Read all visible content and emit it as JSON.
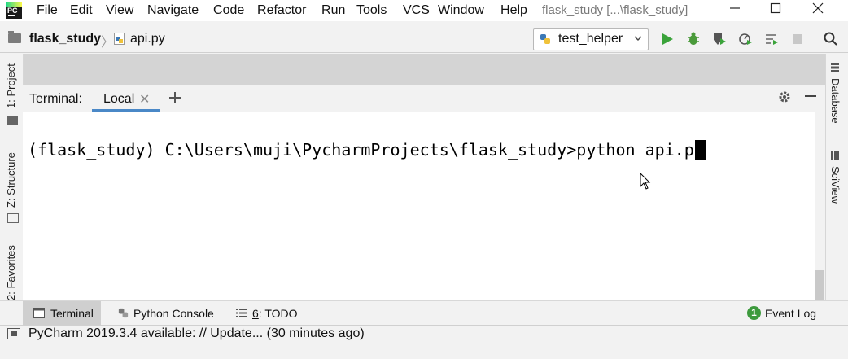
{
  "app": {
    "window_title": "flask_study [...\\flask_study]"
  },
  "menu": {
    "items": [
      "File",
      "Edit",
      "View",
      "Navigate",
      "Code",
      "Refactor",
      "Run",
      "Tools",
      "VCS",
      "Window",
      "Help"
    ]
  },
  "navbar": {
    "project": "flask_study",
    "file": "api.py",
    "run_config": "test_helper"
  },
  "left_stripe": {
    "project": "1: Project",
    "structure": "Z: Structure",
    "favorites": "2: Favorites"
  },
  "right_stripe": {
    "database": "Database",
    "sciview": "SciView"
  },
  "terminal": {
    "title": "Terminal:",
    "tab": "Local",
    "prompt": "(flask_study) C:\\Users\\muji\\PycharmProjects\\flask_study>python api.p"
  },
  "bottom_tabs": {
    "terminal": "Terminal",
    "python_console": "Python Console",
    "todo_prefix": "6",
    "todo": ": TODO",
    "event_log": "Event Log",
    "event_count": "1"
  },
  "status": {
    "text": "PyCharm 2019.3.4 available: // Update... (30 minutes ago)"
  },
  "colors": {
    "tab_underline": "#4a88c7",
    "run_green": "#3aa33a",
    "event_badge": "#3d9a3d"
  }
}
